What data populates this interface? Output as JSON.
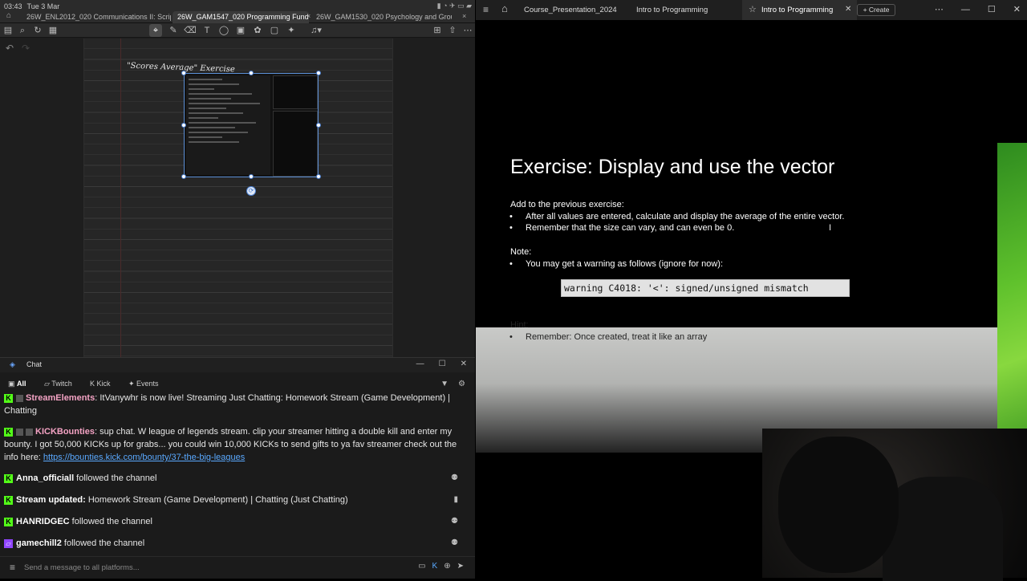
{
  "left_app": {
    "clock": {
      "time": "03:43",
      "date": "Tue 3 Mar"
    },
    "tabs": [
      {
        "label": "26W_ENL2012_020 Communications II: Scriptwriting",
        "active": false
      },
      {
        "label": "26W_GAM1547_020 Programming Fundamentals II",
        "active": true
      },
      {
        "label": "26W_GAM1530_020 Psychology and Group Dynamics",
        "active": false
      }
    ],
    "tab_close": "×",
    "handwriting": "\"Scores Average\" Exercise"
  },
  "chat": {
    "title": "Chat",
    "tabs": {
      "all": "All",
      "twitch": "Twitch",
      "kick": "Kick",
      "events": "Events"
    },
    "messages": [
      {
        "user": "StreamElements",
        "text": ": ItVanywhr is now live! Streaming Just Chatting: Homework Stream (Game Development) | Chatting",
        "platform": "kick"
      },
      {
        "user": "KICKBounties",
        "text": ": sup chat. W league of legends stream. clip your streamer hitting a double kill and enter my bounty. I got 50,000 KICKs up for grabs... you could win 10,000 KICKs to send gifts to ya fav streamer check out the info here: ",
        "link": "https://bounties.kick.com/bounty/37-the-big-leagues",
        "platform": "kick"
      },
      {
        "user": "Anna_officiall",
        "text": " followed the channel",
        "platform": "kick"
      },
      {
        "user": "Stream updated:",
        "text": " Homework Stream (Game Development) | Chatting (Just Chatting)",
        "platform": "kick"
      },
      {
        "user": "HANRIDGEC",
        "text": " followed the channel",
        "platform": "kick"
      },
      {
        "user": "gamechill2",
        "text": " followed the channel",
        "platform": "twitch"
      }
    ],
    "input_placeholder": "Send a message to all platforms..."
  },
  "right_app": {
    "tabs": [
      "Course_Presentation_2024",
      "Intro to Programming"
    ],
    "active_tab": "Intro to Programming",
    "create_label": "+ Create",
    "slide": {
      "title": "Exercise: Display and use the vector",
      "section1_heading": "Add to the previous exercise:",
      "section1_bullets": [
        "After all values are entered, calculate and display the average of the entire vector.",
        "Remember that the size can vary, and can even be 0."
      ],
      "note_heading": "Note:",
      "note_bullet": "You may get a warning as follows (ignore for now):",
      "warning_code": "warning C4018: '<': signed/unsigned mismatch",
      "hint_heading": "Hint:",
      "hint_bullet": "Remember: Once created, treat it like an array"
    }
  },
  "colors": {
    "kick_green": "#53fc18",
    "twitch_purple": "#9146ff",
    "slide_accent": "#5fc12c",
    "link": "#5aa9ff"
  }
}
